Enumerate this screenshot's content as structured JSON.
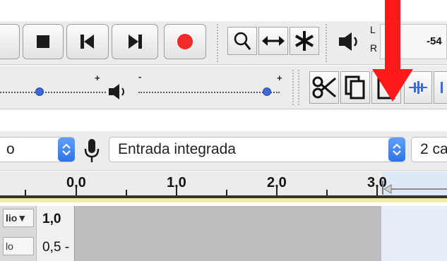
{
  "meter": {
    "left_channel": "L",
    "right_channel": "R",
    "db_label": "-54"
  },
  "ruler": {
    "ticks": [
      "0,0",
      "1,0",
      "2,0",
      "3,0"
    ]
  },
  "device": {
    "host_partial": "o",
    "input_device": "Entrada integrada",
    "channels_partial": "2 ca"
  },
  "track": {
    "name_partial": "lio▼",
    "btn2_partial": "lo",
    "scale_top": "1,0",
    "scale_mid": "0,5 -"
  },
  "sliders": {
    "plus": "+",
    "minus": "-"
  },
  "colors": {
    "record": "#ef2b2b",
    "slider_thumb": "#3f68d8",
    "selection_highlight": "#dfe8f6",
    "annotation_arrow": "#ff1a1a"
  }
}
